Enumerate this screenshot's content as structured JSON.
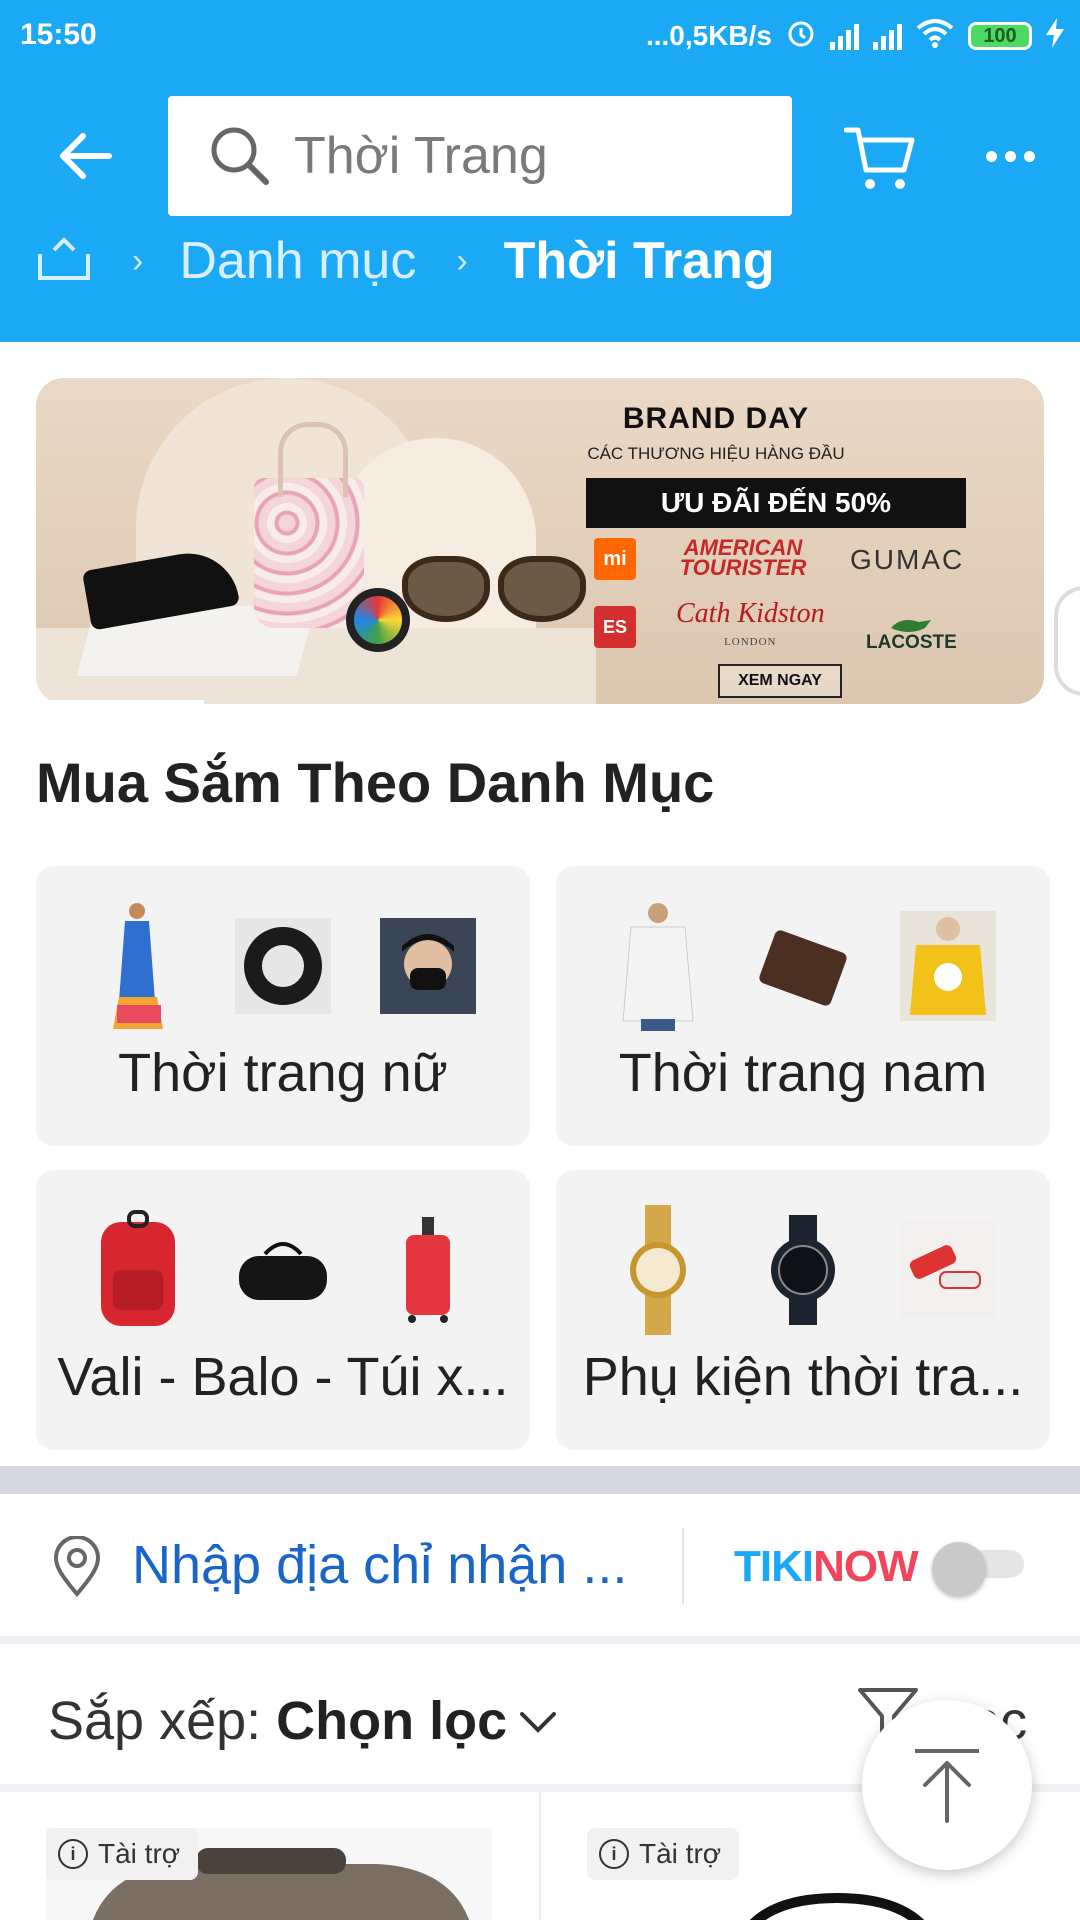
{
  "status_bar": {
    "time": "15:50",
    "net_speed": "...0,5KB/s",
    "battery": "100"
  },
  "header": {
    "search_placeholder": "Thời Trang",
    "breadcrumb": {
      "level1": "Danh mục",
      "level2": "Thời Trang"
    }
  },
  "banner": {
    "title": "BRAND DAY",
    "subtitle": "CÁC THƯƠNG HIỆU HÀNG ĐẦU",
    "deal": "ƯU ĐÃI ĐẾN 50%",
    "brands": {
      "mi": "mi",
      "american_tourister": "AMERICAN TOURISTER",
      "gumac": "GUMAC",
      "es": "ES",
      "cath_kidston": "Cath Kidston",
      "cath_kidston_sub": "LONDON",
      "lacoste": "LACOSTE"
    },
    "cta": "XEM NGAY"
  },
  "categories": {
    "title": "Mua Sắm Theo Danh Mục",
    "items": [
      {
        "label": "Thời trang nữ"
      },
      {
        "label": "Thời trang nam"
      },
      {
        "label": "Vali - Balo - Túi x..."
      },
      {
        "label": "Phụ kiện thời tra..."
      }
    ]
  },
  "address": {
    "text": "Nhập địa chỉ nhận ...",
    "tikinow": {
      "tiki": "TIKI",
      "now": "NOW"
    },
    "toggle_on": false
  },
  "sort": {
    "prefix": "Sắp xếp: ",
    "value": "Chọn lọc",
    "filter_label": "Lọc"
  },
  "products": [
    {
      "badge": "Tài trợ"
    },
    {
      "badge": "Tài trợ"
    }
  ],
  "colors": {
    "header_bg": "#1ba8f5",
    "link_blue": "#1a66c8",
    "tiki_blue": "#1ba8f5",
    "now_red": "#f0455a"
  }
}
